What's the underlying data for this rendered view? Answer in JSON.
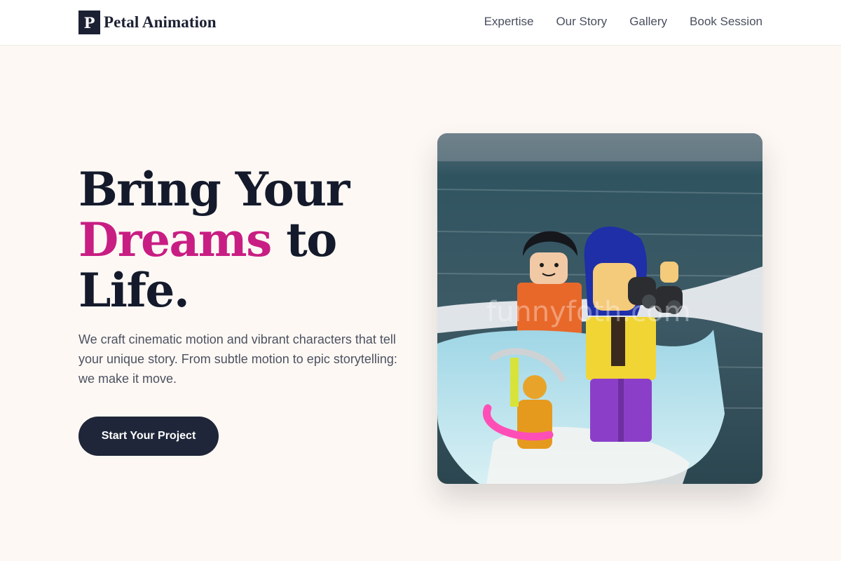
{
  "brand": {
    "mark": "P",
    "name": "Petal Animation"
  },
  "nav": {
    "links": [
      {
        "label": "Expertise"
      },
      {
        "label": "Our Story"
      },
      {
        "label": "Gallery"
      },
      {
        "label": "Book Session"
      }
    ]
  },
  "hero": {
    "title_line1": "Bring Your",
    "title_accent": "Dreams",
    "title_line2_rest": " to",
    "title_line3": "Life.",
    "subtitle": "We craft cinematic motion and vibrant characters that tell your unique story. From subtle motion to epic storytelling: we make it move.",
    "cta_label": "Start Your Project",
    "image_watermark": "funnyfoth.com"
  },
  "colors": {
    "background": "#fdf8f4",
    "accent": "#c81e83",
    "ink": "#141a2b",
    "button": "#1f2639"
  }
}
